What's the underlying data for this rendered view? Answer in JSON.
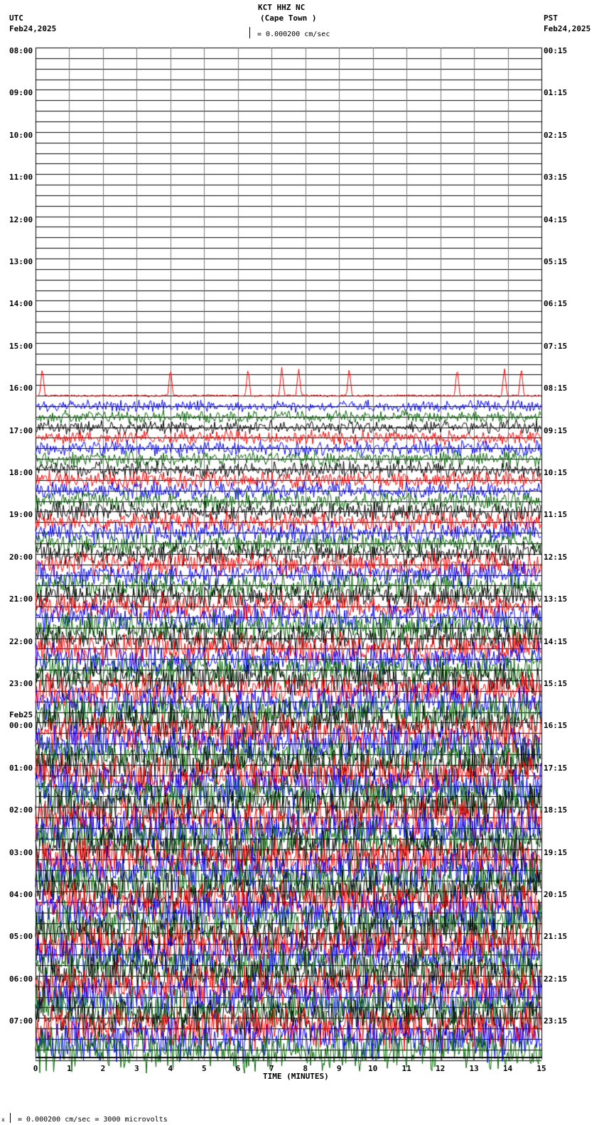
{
  "header": {
    "station": "KCT HHZ NC",
    "location": "(Cape Town )",
    "scale": "= 0.000200 cm/sec",
    "left_tz": "UTC",
    "left_date": "Feb24,2025",
    "right_tz": "PST",
    "right_date": "Feb24,2025"
  },
  "footer": {
    "scale": "= 0.000200 cm/sec =    3000 microvolts",
    "corner_mark": "x"
  },
  "chart_data": {
    "type": "line",
    "title": "KCT HHZ NC (Cape Town )",
    "xlabel": "TIME (MINUTES)",
    "xlim": [
      0,
      15
    ],
    "x_ticks": [
      "0",
      "1",
      "2",
      "3",
      "4",
      "5",
      "6",
      "7",
      "8",
      "9",
      "10",
      "11",
      "12",
      "13",
      "14",
      "15"
    ],
    "rows_per_hour": 4,
    "trace_colors": [
      "#000000",
      "#ff0000",
      "#0000ff",
      "#006400"
    ],
    "left_labels": [
      {
        "text": "08:00"
      },
      {
        "text": "09:00"
      },
      {
        "text": "10:00"
      },
      {
        "text": "11:00"
      },
      {
        "text": "12:00"
      },
      {
        "text": "13:00"
      },
      {
        "text": "14:00"
      },
      {
        "text": "15:00"
      },
      {
        "text": "16:00"
      },
      {
        "text": "17:00"
      },
      {
        "text": "18:00"
      },
      {
        "text": "19:00"
      },
      {
        "text": "20:00"
      },
      {
        "text": "21:00"
      },
      {
        "text": "22:00"
      },
      {
        "text": "23:00"
      },
      {
        "text": "00:00",
        "date": "Feb25"
      },
      {
        "text": "01:00"
      },
      {
        "text": "02:00"
      },
      {
        "text": "03:00"
      },
      {
        "text": "04:00"
      },
      {
        "text": "05:00"
      },
      {
        "text": "06:00"
      },
      {
        "text": "07:00"
      }
    ],
    "right_labels": [
      "00:15",
      "01:15",
      "02:15",
      "03:15",
      "04:15",
      "05:15",
      "06:15",
      "07:15",
      "08:15",
      "09:15",
      "10:15",
      "11:15",
      "12:15",
      "13:15",
      "14:15",
      "15:15",
      "16:15",
      "17:15",
      "18:15",
      "19:15",
      "20:15",
      "21:15",
      "22:15",
      "23:15"
    ],
    "noise_onset_utc": "16:30",
    "quiet_before": "16:30",
    "notable_spikes_minutes_row_1615": [
      0.2,
      4.0,
      6.3,
      7.3,
      7.8,
      9.3,
      12.5,
      13.9,
      14.4
    ]
  }
}
